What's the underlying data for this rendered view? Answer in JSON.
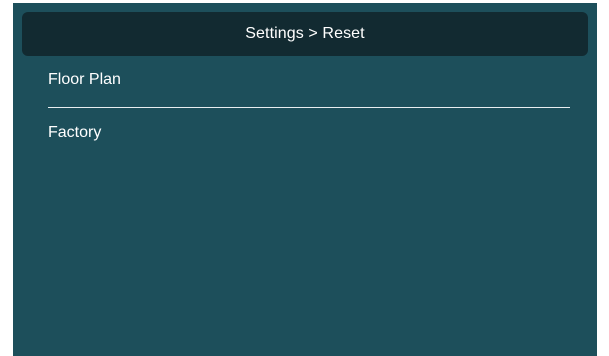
{
  "header": {
    "title": "Settings > Reset"
  },
  "menu": {
    "items": [
      {
        "label": "Floor Plan"
      },
      {
        "label": "Factory"
      }
    ]
  },
  "colors": {
    "background": "#1d4f5b",
    "header_background": "#122a31",
    "text": "#ffffff",
    "divider": "#e8eef0"
  }
}
